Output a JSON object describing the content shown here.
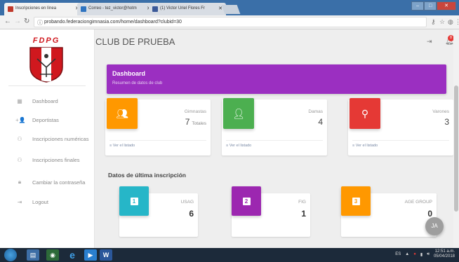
{
  "browser": {
    "tabs": [
      {
        "label": "Inscripciones en línea",
        "fav_color": "#c0392b",
        "active": true
      },
      {
        "label": "Correo - tez_victor@hotm",
        "fav_color": "#2f74c0",
        "active": false
      },
      {
        "label": "(1) Victor Uriel Flores Fr",
        "fav_color": "#3b5998",
        "active": false
      }
    ],
    "url": "probando.federaciongimnasia.com/home/dashboard?clubid=30"
  },
  "logo": {
    "text": "FDPG"
  },
  "sidebar": {
    "items": [
      {
        "label": "Dashboard",
        "icon": "grid-icon"
      },
      {
        "label": "Deportistas",
        "icon": "person-add-icon"
      },
      {
        "label": "Inscripciones numéricas",
        "icon": "people-icon"
      },
      {
        "label": "Inscripciones finales",
        "icon": "people-icon"
      },
      {
        "label": "Cambiar la contraseña",
        "icon": "lock-icon"
      },
      {
        "label": "Logout",
        "icon": "logout-icon"
      }
    ]
  },
  "header": {
    "title": "CLUB DE PRUEBA",
    "notif_count": "8"
  },
  "dashboard": {
    "title": "Dashboard",
    "subtitle": "Resumen de datos de club",
    "color": "#9b2fc1"
  },
  "stats": [
    {
      "label": "Gimnastas",
      "value": "7",
      "unit": "Totales",
      "link": "Ver el listado",
      "color": "#ff9800",
      "icon": "people-icon"
    },
    {
      "label": "Damas",
      "value": "4",
      "unit": "",
      "link": "Ver el listado",
      "color": "#4caf50",
      "icon": "person-icon"
    },
    {
      "label": "Varones",
      "value": "3",
      "unit": "",
      "link": "Ver el listado",
      "color": "#e53935",
      "icon": "person-outline-icon"
    }
  ],
  "last_inscription": {
    "title": "Datos de última inscripción",
    "items": [
      {
        "num": "1",
        "label": "USAG",
        "value": "6",
        "color": "#26b6c8"
      },
      {
        "num": "2",
        "label": "FIG",
        "value": "1",
        "color": "#9c27b0"
      },
      {
        "num": "3",
        "label": "AGE GROUP",
        "value": "0",
        "color": "#ff9800"
      }
    ]
  },
  "user": {
    "initials": "JA"
  },
  "taskbar": {
    "lang": "ES",
    "time": "12:51 a.m.",
    "date": "05/04/2018"
  }
}
